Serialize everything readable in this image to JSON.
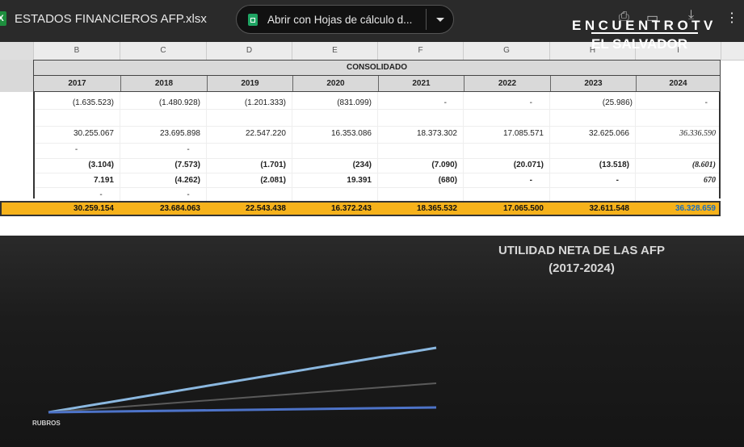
{
  "topbar": {
    "file_icon": "X",
    "file_name": "ESTADOS FINANCIEROS AFP.xlsx",
    "open_with_label": "Abrir con Hojas de cálculo d...",
    "icons": [
      "sheets-icon",
      "dropdown-icon",
      "print-icon",
      "download-icon",
      "more-icon"
    ]
  },
  "logo": {
    "line1": "ENCUENTROTV",
    "line2": "EL SALVADOR"
  },
  "sheet": {
    "column_letters": [
      "B",
      "C",
      "D",
      "E",
      "F",
      "G",
      "H",
      "I"
    ],
    "group_header": "CONSOLIDADO",
    "years": [
      "2017",
      "2018",
      "2019",
      "2020",
      "2021",
      "2022",
      "2023",
      "2024"
    ],
    "rows": [
      {
        "style": "normal",
        "values": [
          "(1.635.523)",
          "(1.480.928)",
          "(1.201.333)",
          "(831.099)",
          "-",
          "-",
          "(25.986)",
          "-"
        ]
      },
      {
        "style": "normal",
        "values": [
          "30.255.067",
          "23.695.898",
          "22.547.220",
          "16.353.086",
          "18.373.302",
          "17.085.571",
          "32.625.066",
          "36.336.590"
        ]
      },
      {
        "style": "normal",
        "values": [
          "-",
          "-",
          "",
          "",
          "",
          "",
          "",
          ""
        ]
      },
      {
        "style": "bold",
        "values": [
          "(3.104)",
          "(7.573)",
          "(1.701)",
          "(234)",
          "(7.090)",
          "(20.071)",
          "(13.518)",
          "(8.601)"
        ]
      },
      {
        "style": "bold",
        "values": [
          "7.191",
          "(4.262)",
          "(2.081)",
          "19.391",
          "(680)",
          "-",
          "-",
          "670"
        ]
      },
      {
        "style": "normal",
        "values": [
          "-",
          "-",
          "",
          "",
          "",
          "",
          "",
          ""
        ]
      }
    ],
    "totals": [
      "30.259.154",
      "23.684.063",
      "22.543.438",
      "16.372.243",
      "18.365.532",
      "17.065.500",
      "32.611.548",
      "36.328.659"
    ],
    "colors": {
      "total_fill": "#f6b21b",
      "header_fill": "#d9d9d9",
      "highlight_text": "#1b6fc1"
    }
  },
  "chart": {
    "title_line1": "UTILIDAD NETA DE LAS AFP",
    "title_line2": "(2017-2024)",
    "axis_label": "RUBROS"
  }
}
